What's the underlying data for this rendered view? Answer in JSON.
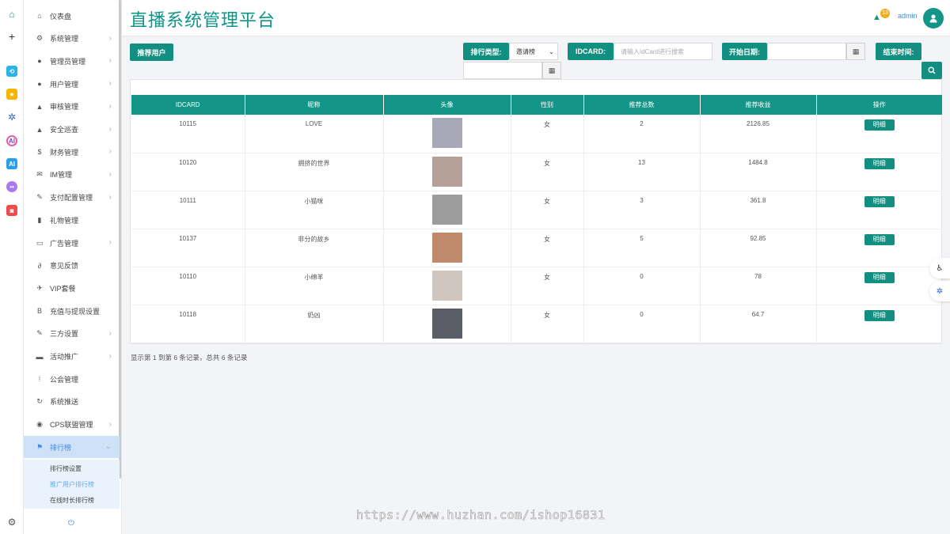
{
  "header": {
    "title": "直播系统管理平台",
    "notif_count": "13",
    "user": "admin"
  },
  "sidebar": {
    "items": [
      {
        "label": "仪表盘",
        "icon": "dashboard-icon",
        "glyph": "⌂",
        "chevron": false
      },
      {
        "label": "系统管理",
        "icon": "cogs-icon",
        "glyph": "⚙",
        "chevron": true
      },
      {
        "label": "管理员管理",
        "icon": "user-icon",
        "glyph": "●",
        "chevron": true
      },
      {
        "label": "用户管理",
        "icon": "user-icon",
        "glyph": "●",
        "chevron": true
      },
      {
        "label": "审核管理",
        "icon": "warning-icon",
        "glyph": "▲",
        "chevron": true
      },
      {
        "label": "安全巡查",
        "icon": "warning-icon",
        "glyph": "▲",
        "chevron": true
      },
      {
        "label": "财务管理",
        "icon": "dollar-icon",
        "glyph": "$",
        "chevron": true
      },
      {
        "label": "IM管理",
        "icon": "envelope-icon",
        "glyph": "✉",
        "chevron": true
      },
      {
        "label": "支付配置管理",
        "icon": "wrench-icon",
        "glyph": "✎",
        "chevron": true
      },
      {
        "label": "礼物管理",
        "icon": "trash-icon",
        "glyph": "▮",
        "chevron": false
      },
      {
        "label": "广告管理",
        "icon": "monitor-icon",
        "glyph": "▭",
        "chevron": true
      },
      {
        "label": "意见反馈",
        "icon": "paperclip-icon",
        "glyph": "∂",
        "chevron": false
      },
      {
        "label": "VIP套餐",
        "icon": "plane-icon",
        "glyph": "✈",
        "chevron": false
      },
      {
        "label": "充值与提现设置",
        "icon": "bitcoin-icon",
        "glyph": "B",
        "chevron": false
      },
      {
        "label": "三方设置",
        "icon": "wrench-icon",
        "glyph": "✎",
        "chevron": true
      },
      {
        "label": "活动推广",
        "icon": "briefcase-icon",
        "glyph": "▬",
        "chevron": true
      },
      {
        "label": "公会管理",
        "icon": "grid-icon",
        "glyph": "⁞",
        "chevron": false
      },
      {
        "label": "系统推送",
        "icon": "refresh-icon",
        "glyph": "↻",
        "chevron": false
      },
      {
        "label": "CPS联盟管理",
        "icon": "globe-icon",
        "glyph": "◉",
        "chevron": true
      },
      {
        "label": "排行榜",
        "icon": "flag-icon",
        "glyph": "⚑",
        "chevron": true,
        "active": true
      }
    ],
    "submenu": [
      "排行榜设置",
      "推广用户排行榜",
      "在线时长排行榜"
    ]
  },
  "toolbar": {
    "recommend_btn": "推荐用户",
    "rank_type_label": "排行类型:",
    "rank_type_value": "邀请榜",
    "idcard_label": "IDCARD:",
    "idcard_placeholder": "请输入IdCard进行搜索",
    "start_label": "开始日期:",
    "end_label": "结束时间:"
  },
  "table": {
    "headers": [
      "IDCARD",
      "昵称",
      "头像",
      "性别",
      "推荐总数",
      "推荐收益",
      "操作"
    ],
    "rows": [
      {
        "id": "10115",
        "nick": "LOVE",
        "gender": "女",
        "count": "2",
        "income": "2126.85",
        "action": "明细",
        "thumb": "#a8a8b8"
      },
      {
        "id": "10120",
        "nick": "拥挤的世界",
        "gender": "女",
        "count": "13",
        "income": "1484.8",
        "action": "明细",
        "thumb": "#b59f96"
      },
      {
        "id": "10111",
        "nick": "小猫咪",
        "gender": "女",
        "count": "3",
        "income": "361.8",
        "action": "明细",
        "thumb": "#9c9c9c"
      },
      {
        "id": "10137",
        "nick": "非分的故乡",
        "gender": "女",
        "count": "5",
        "income": "92.85",
        "action": "明细",
        "thumb": "#c08a6a"
      },
      {
        "id": "10110",
        "nick": "小绵羊",
        "gender": "女",
        "count": "0",
        "income": "78",
        "action": "明细",
        "thumb": "#cfc7bf"
      },
      {
        "id": "10118",
        "nick": "奶凶",
        "gender": "女",
        "count": "0",
        "income": "64.7",
        "action": "明细",
        "thumb": "#5a5d66"
      }
    ]
  },
  "pagination_text": "显示第 1 到第 6 条记录，总共 6 条记录",
  "watermark": "https://www.huzhan.com/ishop16831",
  "colors": {
    "primary": "#128f80",
    "title": "#0d9488",
    "link": "#3c8dde",
    "badge": "#f0ad1e"
  }
}
